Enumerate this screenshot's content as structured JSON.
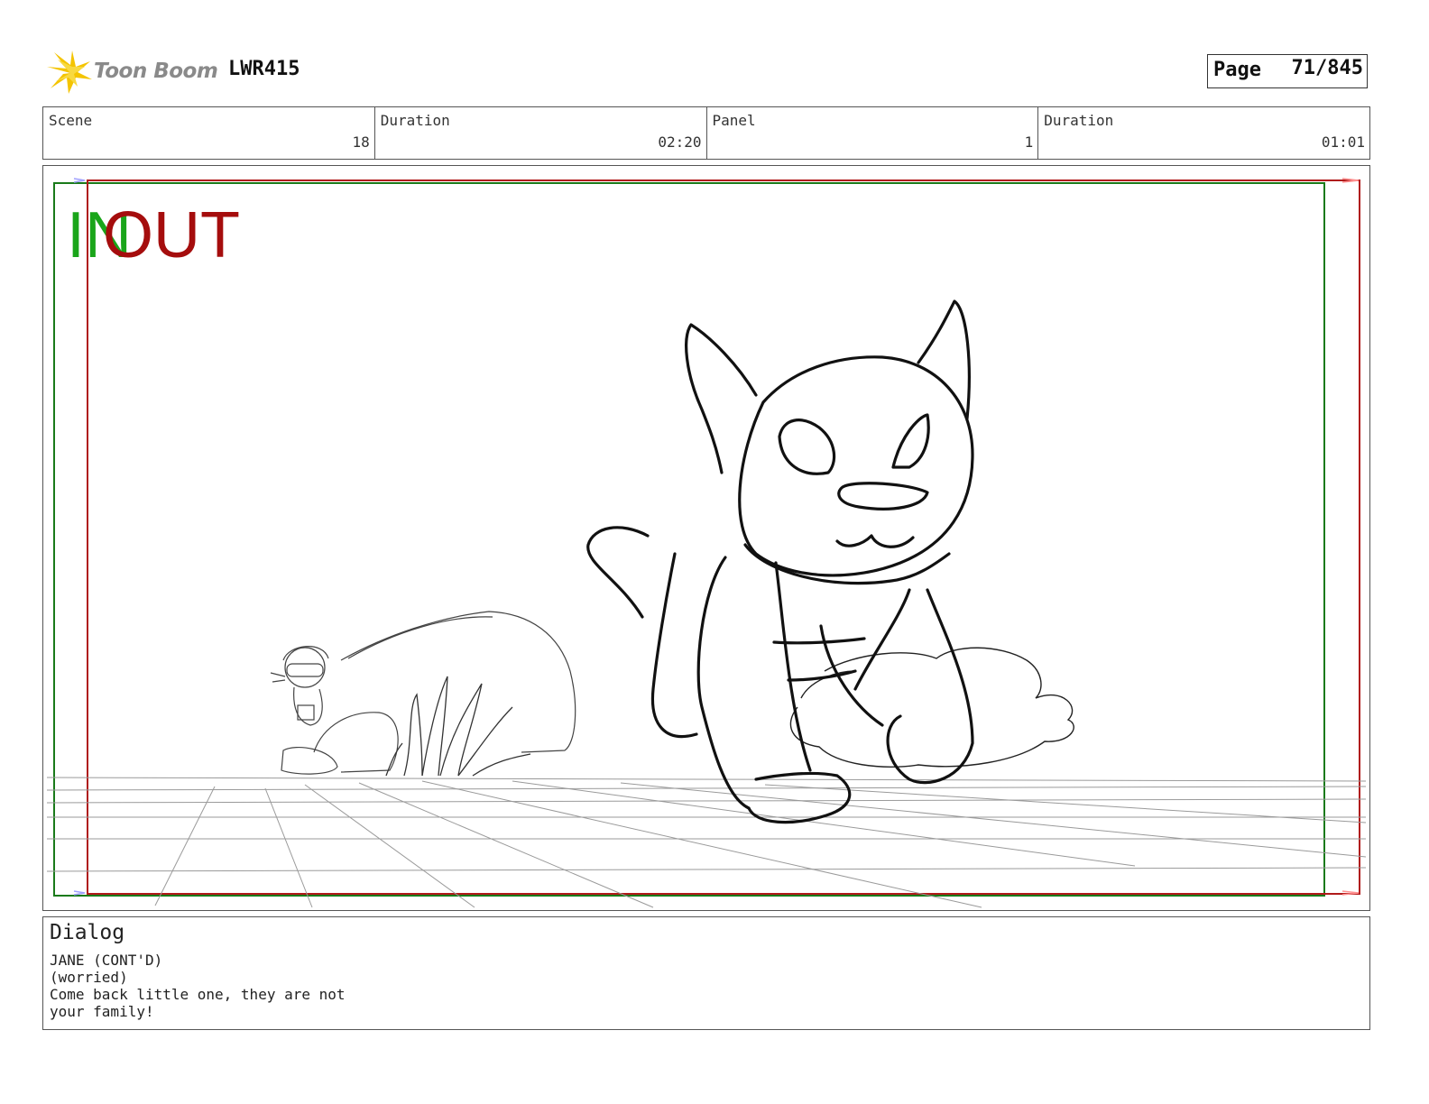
{
  "header": {
    "logo_text": "Toon Boom",
    "project": "LWR415",
    "page_label": "Page",
    "page_value": "71/845"
  },
  "info": {
    "scene_label": "Scene",
    "scene_value": "18",
    "scene_duration_label": "Duration",
    "scene_duration_value": "02:20",
    "panel_label": "Panel",
    "panel_value": "1",
    "panel_duration_label": "Duration",
    "panel_duration_value": "01:01"
  },
  "frame": {
    "in_label": "IN",
    "out_label": "OUT",
    "in_color": "#1aa51a",
    "out_color": "#a50d0d"
  },
  "dialog": {
    "title": "Dialog",
    "lines": [
      "JANE (CONT'D)",
      "(worried)",
      "Come back little one, they are not",
      "your family!"
    ]
  }
}
